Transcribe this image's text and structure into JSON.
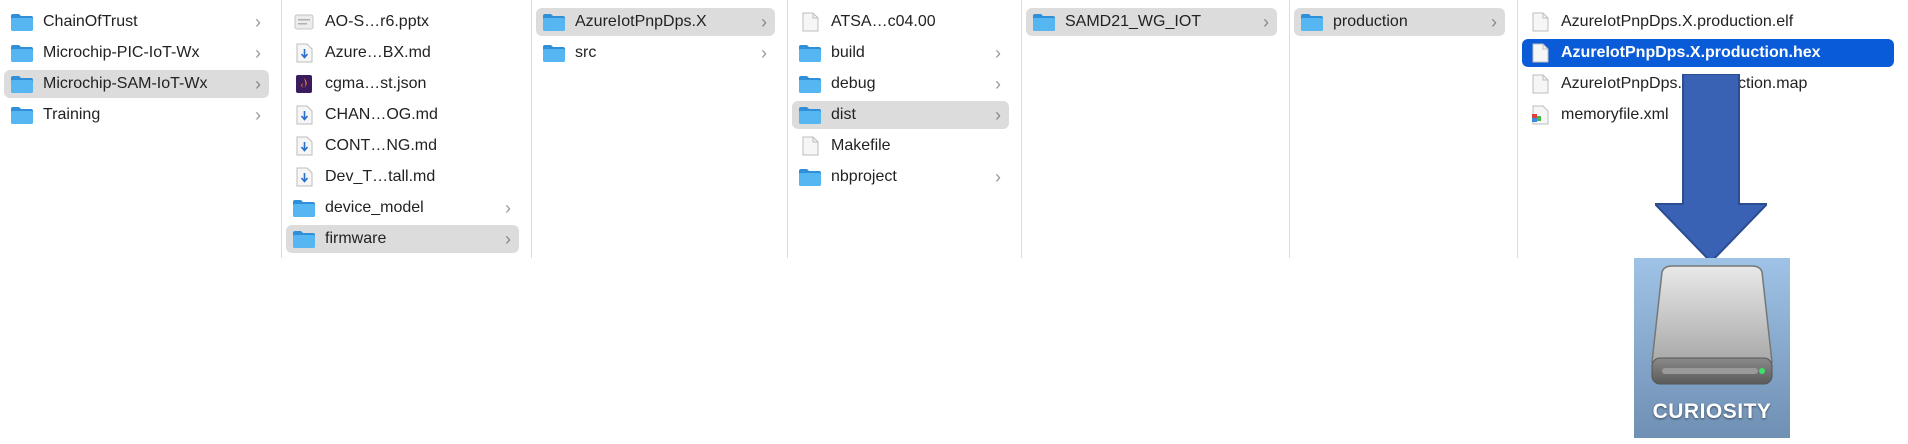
{
  "columns": [
    {
      "items": [
        {
          "label": "ChainOfTrust",
          "icon": "folder-icon",
          "chevron": true,
          "state": "none"
        },
        {
          "label": "Microchip-PIC-IoT-Wx",
          "icon": "folder-icon",
          "chevron": true,
          "state": "none"
        },
        {
          "label": "Microchip-SAM-IoT-Wx",
          "icon": "folder-icon",
          "chevron": true,
          "state": "selected"
        },
        {
          "label": "Training",
          "icon": "folder-icon",
          "chevron": true,
          "state": "none"
        }
      ]
    },
    {
      "items": [
        {
          "label": "AO-S…r6.pptx",
          "icon": "pptx-file-icon",
          "chevron": false,
          "state": "none"
        },
        {
          "label": "Azure…BX.md",
          "icon": "markdown-file-icon",
          "chevron": false,
          "state": "none"
        },
        {
          "label": "cgma…st.json",
          "icon": "json-file-icon",
          "chevron": false,
          "state": "none"
        },
        {
          "label": "CHAN…OG.md",
          "icon": "markdown-file-icon",
          "chevron": false,
          "state": "none"
        },
        {
          "label": "CONT…NG.md",
          "icon": "markdown-file-icon",
          "chevron": false,
          "state": "none"
        },
        {
          "label": "Dev_T…tall.md",
          "icon": "markdown-file-icon",
          "chevron": false,
          "state": "none"
        },
        {
          "label": "device_model",
          "icon": "folder-icon",
          "chevron": true,
          "state": "none"
        },
        {
          "label": "firmware",
          "icon": "folder-icon",
          "chevron": true,
          "state": "selected"
        }
      ]
    },
    {
      "items": [
        {
          "label": "AzureIotPnpDps.X",
          "icon": "folder-icon",
          "chevron": true,
          "state": "selected"
        },
        {
          "label": "src",
          "icon": "folder-icon",
          "chevron": true,
          "state": "none"
        }
      ]
    },
    {
      "items": [
        {
          "label": "ATSA…c04.00",
          "icon": "generic-file-icon",
          "chevron": false,
          "state": "none"
        },
        {
          "label": "build",
          "icon": "folder-icon",
          "chevron": true,
          "state": "none"
        },
        {
          "label": "debug",
          "icon": "folder-icon",
          "chevron": true,
          "state": "none"
        },
        {
          "label": "dist",
          "icon": "folder-icon",
          "chevron": true,
          "state": "selected"
        },
        {
          "label": "Makefile",
          "icon": "generic-file-icon",
          "chevron": false,
          "state": "none"
        },
        {
          "label": "nbproject",
          "icon": "folder-icon",
          "chevron": true,
          "state": "none"
        }
      ]
    },
    {
      "items": [
        {
          "label": "SAMD21_WG_IOT",
          "icon": "folder-icon",
          "chevron": true,
          "state": "selected"
        }
      ]
    },
    {
      "items": [
        {
          "label": "production",
          "icon": "folder-icon",
          "chevron": true,
          "state": "selected"
        }
      ]
    },
    {
      "items": [
        {
          "label": "AzureIotPnpDps.X.production.elf",
          "icon": "generic-file-icon",
          "chevron": false,
          "state": "none"
        },
        {
          "label": "AzureIotPnpDps.X.production.hex",
          "icon": "generic-file-icon",
          "chevron": false,
          "state": "active"
        },
        {
          "label": "AzureIotPnpDps.X.production.map",
          "icon": "generic-file-icon",
          "chevron": false,
          "state": "none"
        },
        {
          "label": "memoryfile.xml",
          "icon": "xml-file-icon",
          "chevron": false,
          "state": "none"
        }
      ]
    }
  ],
  "drive": {
    "label": "CURIOSITY",
    "icon": "external-drive-icon"
  },
  "arrow": {
    "icon": "down-arrow-icon",
    "color": "#3a62b4"
  },
  "colors": {
    "folder": "#3ea7ef",
    "selected_bg": "#dcdcdc",
    "active_bg": "#0a5bd8"
  }
}
